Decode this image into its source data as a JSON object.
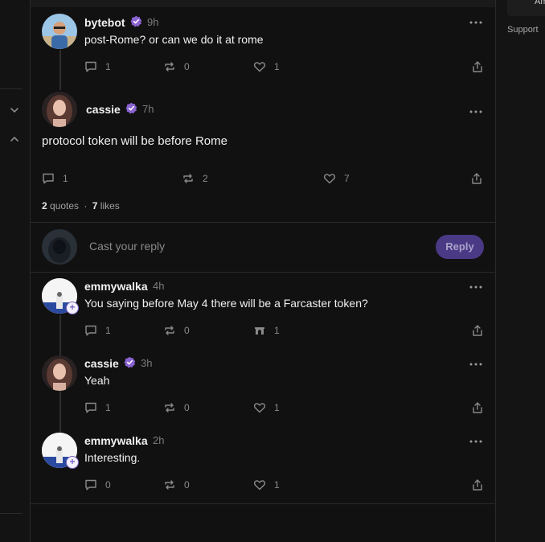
{
  "posts": [
    {
      "name": "bytebot",
      "time": "9h",
      "text": "post-Rome? or can we do it at rome",
      "replies": "1",
      "recasts": "0",
      "likes": "1"
    },
    {
      "name": "cassie",
      "time": "7h",
      "text": "protocol token will be before Rome",
      "replies": "1",
      "recasts": "2",
      "likes": "7"
    }
  ],
  "stats": {
    "quotes_count": "2",
    "quotes_label": "quotes",
    "separator": "·",
    "likes_count": "7",
    "likes_label": "likes"
  },
  "reply": {
    "placeholder": "Cast your reply",
    "button": "Reply"
  },
  "replies": [
    {
      "name": "emmywalka",
      "time": "4h",
      "text": "You saying before May 4 there will be a Farcaster token?",
      "replies": "1",
      "recasts": "0",
      "likes": "1"
    },
    {
      "name": "cassie",
      "time": "3h",
      "text": "Yeah",
      "replies": "1",
      "recasts": "0",
      "likes": "1"
    },
    {
      "name": "emmywalka",
      "time": "2h",
      "text": "Interesting.",
      "replies": "0",
      "recasts": "0",
      "likes": "1"
    }
  ],
  "right_rail": {
    "support": "Support",
    "top_box": "Am"
  },
  "colors": {
    "background": "#111111",
    "verified": "#8a63d2",
    "reply_button": "#4a3a86",
    "divider": "#2a2a2a"
  },
  "icons": [
    "verified-badge-icon",
    "more-dots-icon",
    "comment-icon",
    "recast-icon",
    "heart-icon",
    "share-icon",
    "chevron-down-icon",
    "chevron-up-icon",
    "plus-icon",
    "arch-icon"
  ]
}
